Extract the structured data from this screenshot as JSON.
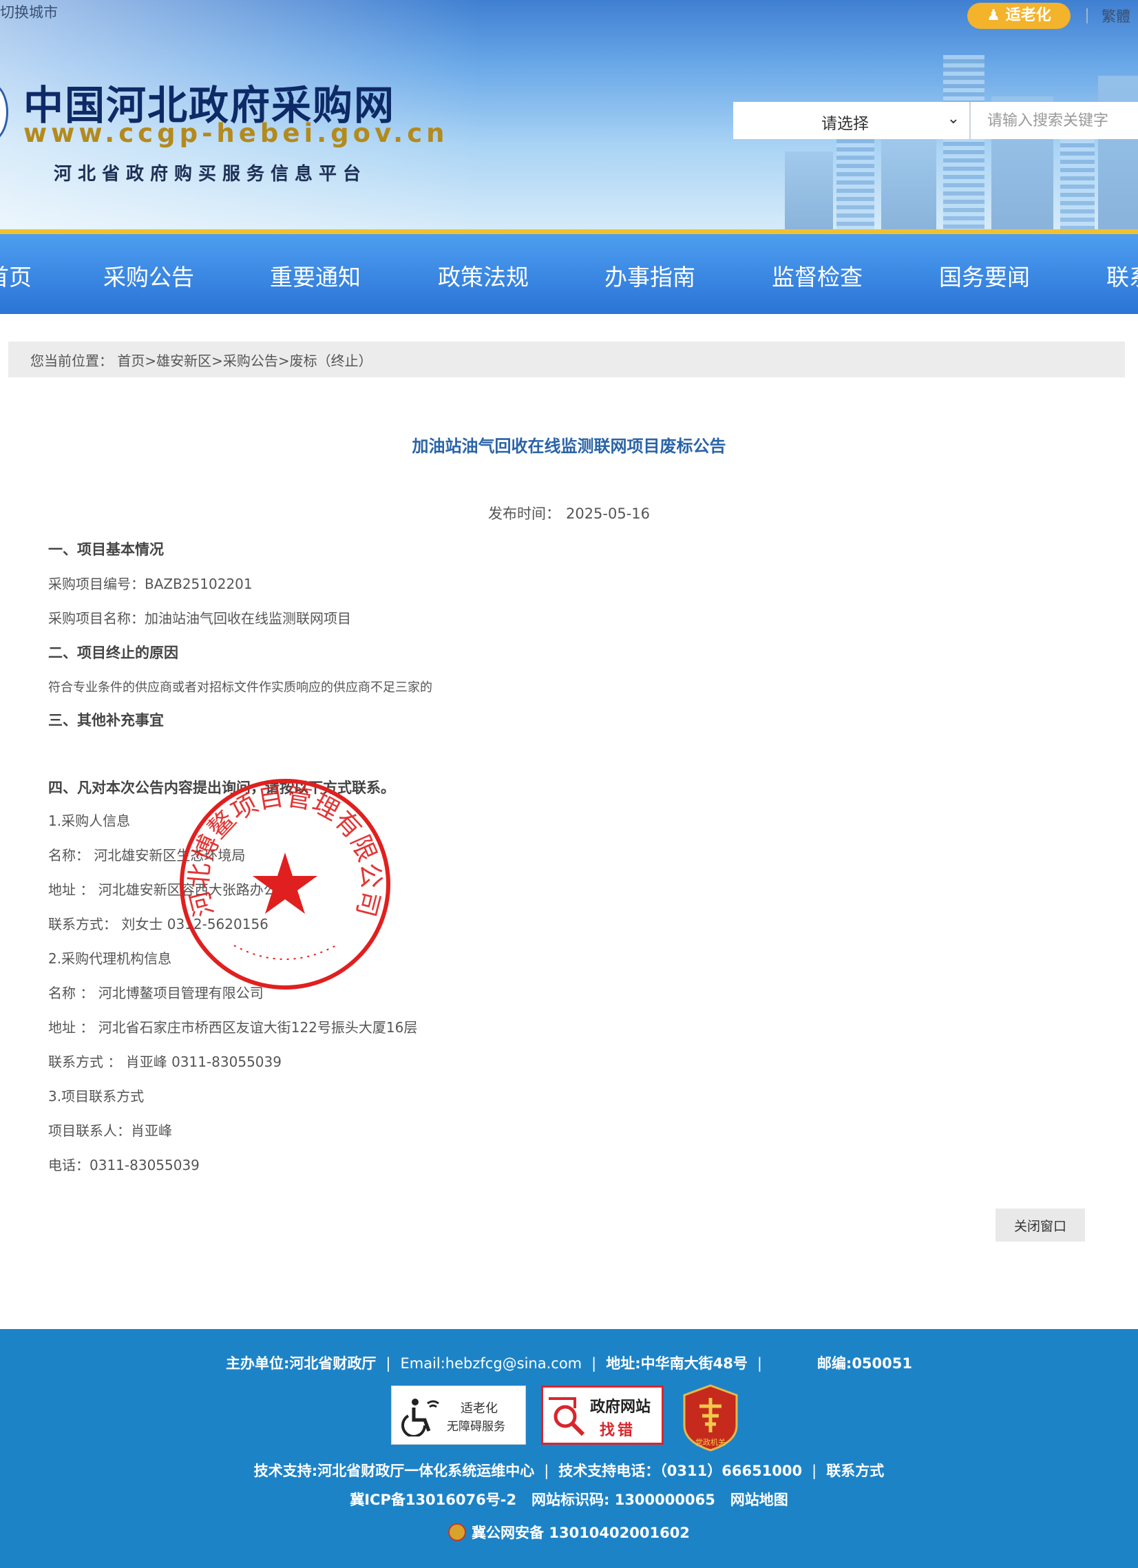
{
  "header": {
    "switch_city": "切换城市",
    "elder_mode": "适老化",
    "traditional": "繁體",
    "site_title": "中国河北政府采购网",
    "site_url": "www.ccgp-hebei.gov.cn",
    "site_subtitle": "河北省政府购买服务信息平台",
    "search_select": "请选择",
    "search_placeholder": "请输入搜索关键字"
  },
  "nav": {
    "items": [
      "首页",
      "采购公告",
      "重要通知",
      "政策法规",
      "办事指南",
      "监督检查",
      "国务要闻",
      "联系我们"
    ]
  },
  "breadcrumb": {
    "label": "您当前位置：",
    "path": "首页>雄安新区>采购公告>废标（终止）"
  },
  "article": {
    "title": "加油站油气回收在线监测联网项目废标公告",
    "publish_label": "发布时间：",
    "publish_date": "2025-05-16",
    "sec1_heading": "一、项目基本情况",
    "project_no": "采购项目编号：BAZB25102201",
    "project_name": "采购项目名称：加油站油气回收在线监测联网项目",
    "sec2_heading": "二、项目终止的原因",
    "reason": "符合专业条件的供应商或者对招标文件作实质响应的供应商不足三家的",
    "sec3_heading": "三、其他补充事宜",
    "sec4_heading": "四、凡对本次公告内容提出询问，请按以下方式联系。",
    "buyer_heading": "1.采购人信息",
    "buyer_name": "名称： 河北雄安新区生态环境局",
    "buyer_address": "地址 ： 河北雄安新区容西大张路办公楼",
    "buyer_contact": "联系方式： 刘女士 0312-5620156",
    "agency_heading": "2.采购代理机构信息",
    "agency_name": "名称 ： 河北博鳌项目管理有限公司",
    "agency_address": "地址 ： 河北省石家庄市桥西区友谊大街122号振头大厦16层",
    "agency_contact": "联系方式 ： 肖亚峰 0311-83055039",
    "project_contact_heading": "3.项目联系方式",
    "project_contact_person": "项目联系人：肖亚峰",
    "project_contact_phone": "电话：0311-83055039",
    "close_button": "关闭窗口",
    "seal_text": "河北博鳌项目管理有限公司",
    "seal_color": "#e0201f"
  },
  "footer": {
    "host": "主办单位:河北省财政厅",
    "email": "Email:hebzfcg@sina.com",
    "address": "地址:中华南大街48号",
    "postcode": "邮编:050051",
    "badge_elder_1": "适老化",
    "badge_elder_2": "无障碍服务",
    "badge_gov_1": "政府网站",
    "badge_gov_2": "找错",
    "badge_party": "党政机关",
    "tech_support": "技术支持:河北省财政厅一体化系统运维中心",
    "tech_phone": "技术支持电话：（0311）66651000",
    "contact": "联系方式",
    "icp": "冀ICP备13016076号-2",
    "site_id": "网站标识码: 1300000065",
    "sitemap": "网站地图",
    "police": "冀公网安备 13010402001602"
  },
  "colors": {
    "nav_blue": "#2b74d6",
    "footer_blue": "#1d83c7",
    "title_blue": "#2a63a8",
    "elder_orange": "#f3b32a"
  }
}
